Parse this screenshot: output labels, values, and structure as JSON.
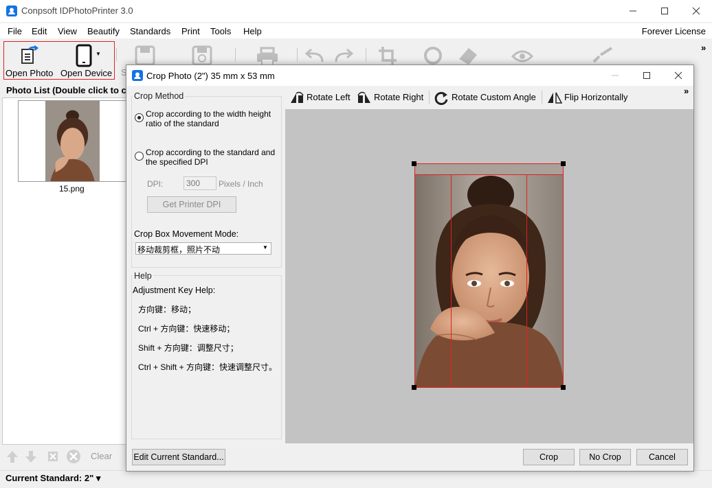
{
  "app": {
    "title": "Conpsoft IDPhotoPrinter 3.0",
    "license": "Forever License",
    "menu": [
      "File",
      "Edit",
      "View",
      "Beautify",
      "Standards",
      "Print",
      "Tools",
      "Help"
    ]
  },
  "toolbar": {
    "open_photo": "Open Photo",
    "open_device": "Open Device",
    "overflow": "»",
    "truncated_label": "S"
  },
  "photo_list": {
    "header": "Photo List (Double click to c",
    "items": [
      {
        "caption": "15.png"
      }
    ],
    "clear_label": "Clear"
  },
  "status": {
    "current_standard": "Current Standard: 2\" ▾"
  },
  "dialog": {
    "title": "Crop Photo (2\") 35 mm x 53 mm",
    "crop_method": {
      "title": "Crop Method",
      "option1": "Crop according to the width height ratio of the standard",
      "option2": "Crop according to the standard and the specified DPI",
      "dpi_label": "DPI:",
      "dpi_value": "300",
      "dpi_unit": "Pixels / Inch",
      "get_printer_dpi": "Get Printer DPI",
      "movement_label": "Crop Box Movement Mode:",
      "movement_value": "移动裁剪框，照片不动"
    },
    "help": {
      "title": "Help",
      "heading": "Adjustment Key Help:",
      "lines": [
        "方向键：移动；",
        "Ctrl + 方向键：快速移动；",
        "Shift + 方向键：调整尺寸；",
        "Ctrl + Shift + 方向键：快速调整尺寸。"
      ]
    },
    "tools": {
      "rotate_left": "Rotate Left",
      "rotate_right": "Rotate Right",
      "rotate_custom": "Rotate Custom Angle",
      "flip_h": "Flip Horizontally",
      "overflow": "»"
    },
    "buttons": {
      "edit_standard": "Edit Current Standard...",
      "crop": "Crop",
      "no_crop": "No Crop",
      "cancel": "Cancel"
    }
  },
  "colors": {
    "accent": "#1473e6",
    "crop_line": "#e02020",
    "canvas_bg": "#c3c3c3"
  }
}
